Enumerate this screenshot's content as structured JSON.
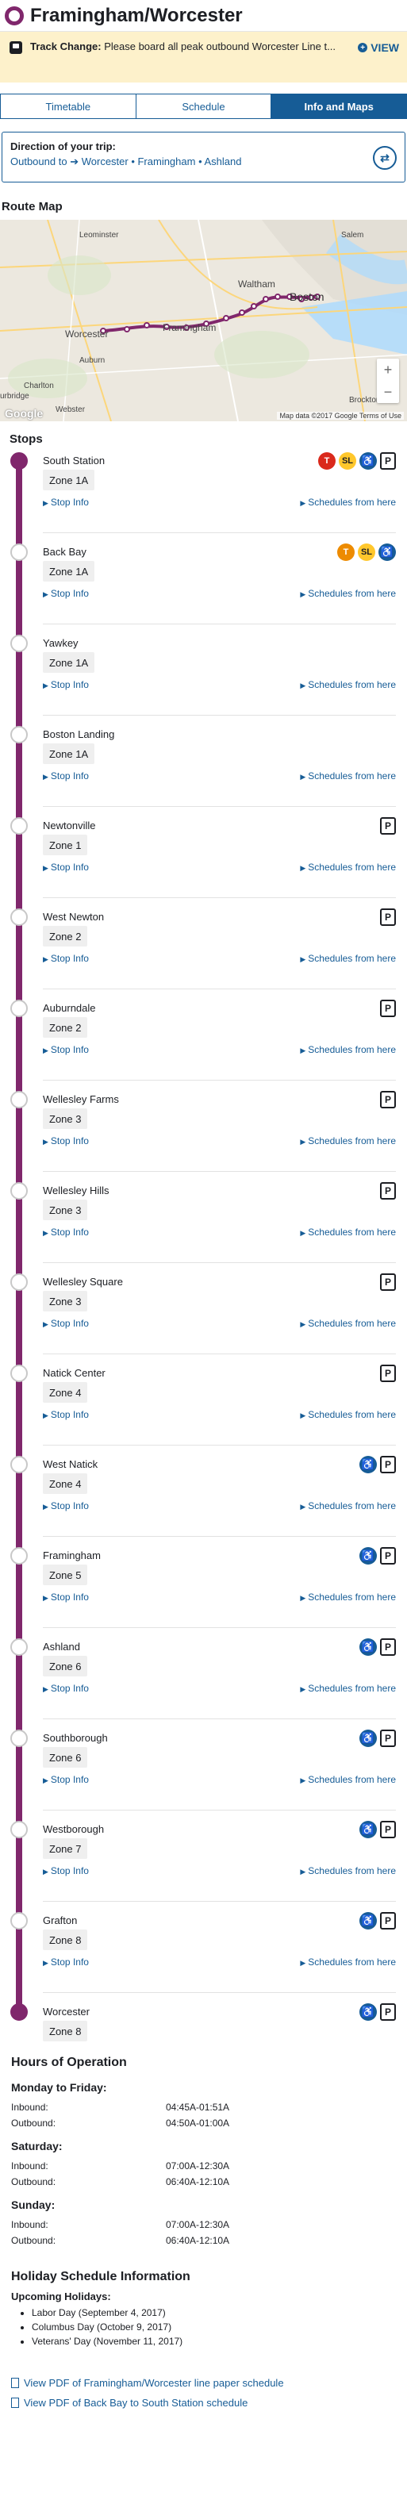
{
  "header": {
    "title": "Framingham/Worcester"
  },
  "alert": {
    "label": "Track Change:",
    "text": "Please board all peak outbound Worcester Line t...",
    "view": "VIEW"
  },
  "tabs": [
    {
      "label": "Timetable"
    },
    {
      "label": "Schedule"
    },
    {
      "label": "Info and Maps"
    }
  ],
  "direction": {
    "label": "Direction of your trip:",
    "prefix": "Outbound to",
    "value": "Worcester • Framingham • Ashland"
  },
  "map": {
    "title": "Route Map",
    "footer": "Map data ©2017 Google   Terms of Use",
    "google": "Google",
    "labels": [
      "Leominster",
      "Salem",
      "Waltham",
      "Boston",
      "Worcester",
      "Framingham",
      "Auburn",
      "Charlton",
      "Webster",
      "Brockton",
      "urbridge"
    ]
  },
  "stops_title": "Stops",
  "stop_links": {
    "info": "Stop Info",
    "schedules": "Schedules from here"
  },
  "stops": [
    {
      "name": "South Station",
      "zone": "Zone 1A",
      "badges": [
        "T",
        "S",
        "acc",
        "P"
      ]
    },
    {
      "name": "Back Bay",
      "zone": "Zone 1A",
      "badges": [
        "O",
        "S",
        "acc"
      ]
    },
    {
      "name": "Yawkey",
      "zone": "Zone 1A",
      "badges": []
    },
    {
      "name": "Boston Landing",
      "zone": "Zone 1A",
      "badges": []
    },
    {
      "name": "Newtonville",
      "zone": "Zone 1",
      "badges": [
        "P"
      ]
    },
    {
      "name": "West Newton",
      "zone": "Zone 2",
      "badges": [
        "P"
      ]
    },
    {
      "name": "Auburndale",
      "zone": "Zone 2",
      "badges": [
        "P"
      ]
    },
    {
      "name": "Wellesley Farms",
      "zone": "Zone 3",
      "badges": [
        "P"
      ]
    },
    {
      "name": "Wellesley Hills",
      "zone": "Zone 3",
      "badges": [
        "P"
      ]
    },
    {
      "name": "Wellesley Square",
      "zone": "Zone 3",
      "badges": [
        "P"
      ]
    },
    {
      "name": "Natick Center",
      "zone": "Zone 4",
      "badges": [
        "P"
      ]
    },
    {
      "name": "West Natick",
      "zone": "Zone 4",
      "badges": [
        "acc",
        "P"
      ]
    },
    {
      "name": "Framingham",
      "zone": "Zone 5",
      "badges": [
        "acc",
        "P"
      ]
    },
    {
      "name": "Ashland",
      "zone": "Zone 6",
      "badges": [
        "acc",
        "P"
      ]
    },
    {
      "name": "Southborough",
      "zone": "Zone 6",
      "badges": [
        "acc",
        "P"
      ]
    },
    {
      "name": "Westborough",
      "zone": "Zone 7",
      "badges": [
        "acc",
        "P"
      ]
    },
    {
      "name": "Grafton",
      "zone": "Zone 8",
      "badges": [
        "acc",
        "P"
      ]
    },
    {
      "name": "Worcester",
      "zone": "Zone 8",
      "badges": [
        "acc",
        "P"
      ]
    }
  ],
  "hours": {
    "title": "Hours of Operation",
    "days": [
      {
        "day": "Monday to Friday:",
        "inbound_label": "Inbound:",
        "inbound": "04:45A-01:51A",
        "outbound_label": "Outbound:",
        "outbound": "04:50A-01:00A"
      },
      {
        "day": "Saturday:",
        "inbound_label": "Inbound:",
        "inbound": "07:00A-12:30A",
        "outbound_label": "Outbound:",
        "outbound": "06:40A-12:10A"
      },
      {
        "day": "Sunday:",
        "inbound_label": "Inbound:",
        "inbound": "07:00A-12:30A",
        "outbound_label": "Outbound:",
        "outbound": "06:40A-12:10A"
      }
    ]
  },
  "holiday": {
    "title": "Holiday Schedule Information",
    "subtitle": "Upcoming Holidays:",
    "items": [
      "Labor Day (September 4, 2017)",
      "Columbus Day (October 9, 2017)",
      "Veterans' Day (November 11, 2017)"
    ]
  },
  "pdfs": [
    "View PDF of Framingham/Worcester line paper schedule",
    "View PDF of Back Bay to South Station schedule"
  ],
  "colors": {
    "route": "#80276c",
    "link": "#165c96",
    "alert": "#fdf1cb"
  }
}
